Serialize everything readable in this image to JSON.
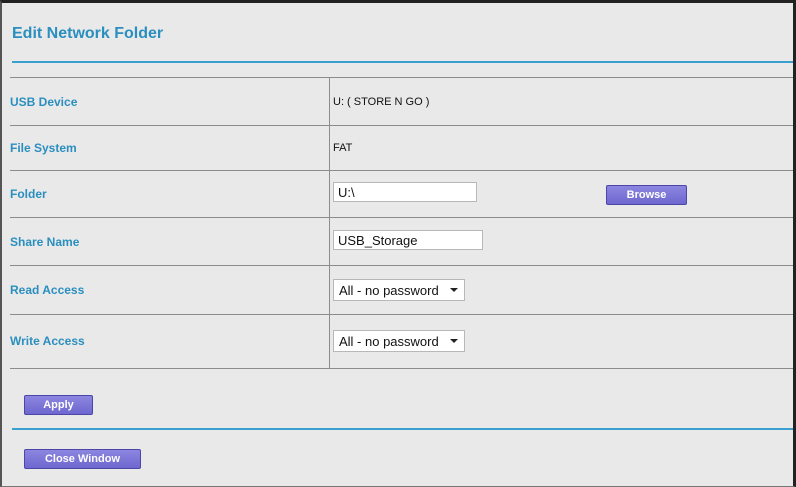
{
  "window": {
    "title": "Edit Network Folder"
  },
  "fields": {
    "usb_device": {
      "label": "USB Device",
      "value": "U: ( STORE N GO )"
    },
    "file_system": {
      "label": "File System",
      "value": "FAT"
    },
    "folder": {
      "label": "Folder",
      "value": "U:\\",
      "browse_label": "Browse"
    },
    "share_name": {
      "label": "Share Name",
      "value": "USB_Storage"
    },
    "read_access": {
      "label": "Read Access",
      "selected": "All - no password"
    },
    "write_access": {
      "label": "Write Access",
      "selected": "All - no password"
    }
  },
  "actions": {
    "apply_label": "Apply",
    "close_label": "Close Window"
  },
  "colors": {
    "accent": "#2a8fbf",
    "button": "#7a73d8",
    "panel": "#e9e9e9"
  }
}
